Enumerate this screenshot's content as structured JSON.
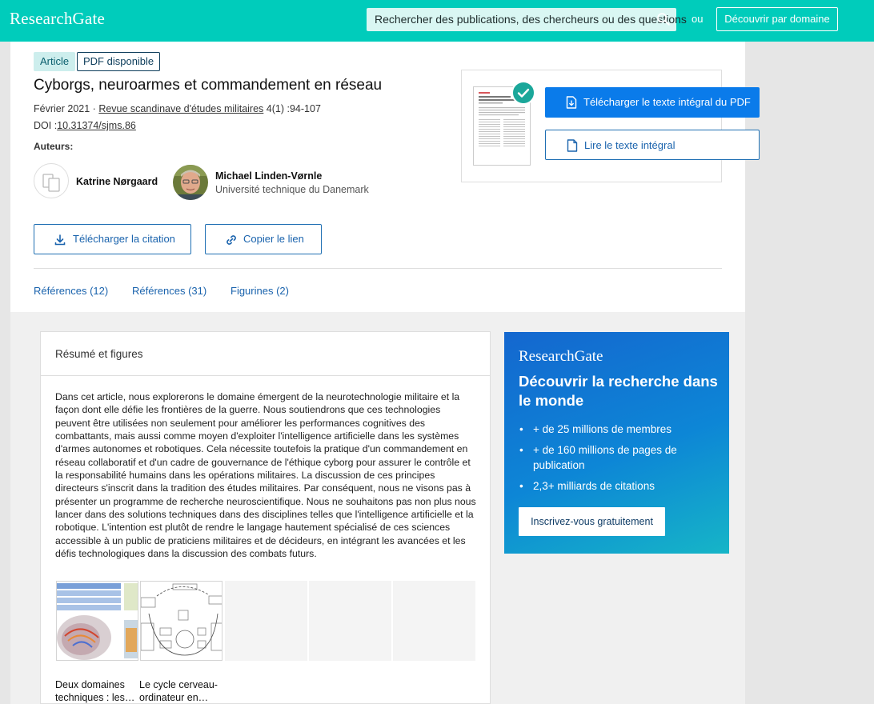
{
  "header": {
    "logo": "ResearchGate",
    "search_placeholder": "Rechercher des publications, des chercheurs ou des questions",
    "or_label": "ou",
    "discover_button": "Découvrir par domaine"
  },
  "publication": {
    "tags": [
      "Article",
      "PDF disponible"
    ],
    "title": "Cyborgs, neuroarmes et commandement en réseau",
    "date": "Février 2021",
    "meta_separator": "·",
    "journal": "Revue scandinave d'études militaires",
    "issue": "4(1) :94-107",
    "doi_label": "DOI :",
    "doi": "10.31374/sjms.86",
    "authors_label": "Auteurs:",
    "authors": [
      {
        "name": "Katrine Nørgaard",
        "affiliation": ""
      },
      {
        "name": "Michael Linden-Vørnle",
        "affiliation": "Université technique du Danemark"
      }
    ]
  },
  "actions": {
    "download_citation": "Télécharger la citation",
    "copy_link": "Copier le lien",
    "download_pdf": "Télécharger le texte intégral du PDF",
    "read_full_text": "Lire le texte intégral"
  },
  "tabs": [
    "Références (12)",
    "Références (31)",
    "Figurines (2)"
  ],
  "abstract": {
    "heading": "Résumé et figures",
    "text": "Dans cet article, nous explorerons le domaine émergent de la neurotechnologie militaire et la façon dont elle défie les frontières de la guerre. Nous soutiendrons que ces technologies peuvent être utilisées non seulement pour améliorer les performances cognitives des combattants, mais aussi comme moyen d'exploiter l'intelligence artificielle dans les systèmes d'armes autonomes et robotiques. Cela nécessite toutefois la pratique d'un commandement en réseau collaboratif et d'un cadre de gouvernance de l'éthique cyborg pour assurer le contrôle et la responsabilité humains dans les opérations militaires. La discussion de ces principes directeurs s'inscrit dans la tradition des études militaires. Par conséquent, nous ne visons pas à présenter un programme de recherche neuroscientifique. Nous ne souhaitons pas non plus nous lancer dans des solutions techniques dans des disciplines telles que l'intelligence artificielle et la robotique. L'intention est plutôt de rendre le langage hautement spécialisé de ces sciences accessible à un public de praticiens militaires et de décideurs, en intégrant les avancées et les défis technologiques dans la discussion des combats futurs.",
    "figures": [
      {
        "caption": "Deux domaines techniques : les…"
      },
      {
        "caption": "Le cycle cerveau-ordinateur en…"
      }
    ]
  },
  "promo": {
    "logo": "ResearchGate",
    "heading": "Découvrir la recherche dans le monde",
    "items": [
      "+ de 25 millions de membres",
      "+ de 160 millions de pages de publication",
      "2,3+ milliards de citations"
    ],
    "cta": "Inscrivez-vous gratuitement"
  },
  "colors": {
    "brand": "#00ccbb",
    "primary_button": "#0a7bea",
    "link": "#1a63ad"
  }
}
